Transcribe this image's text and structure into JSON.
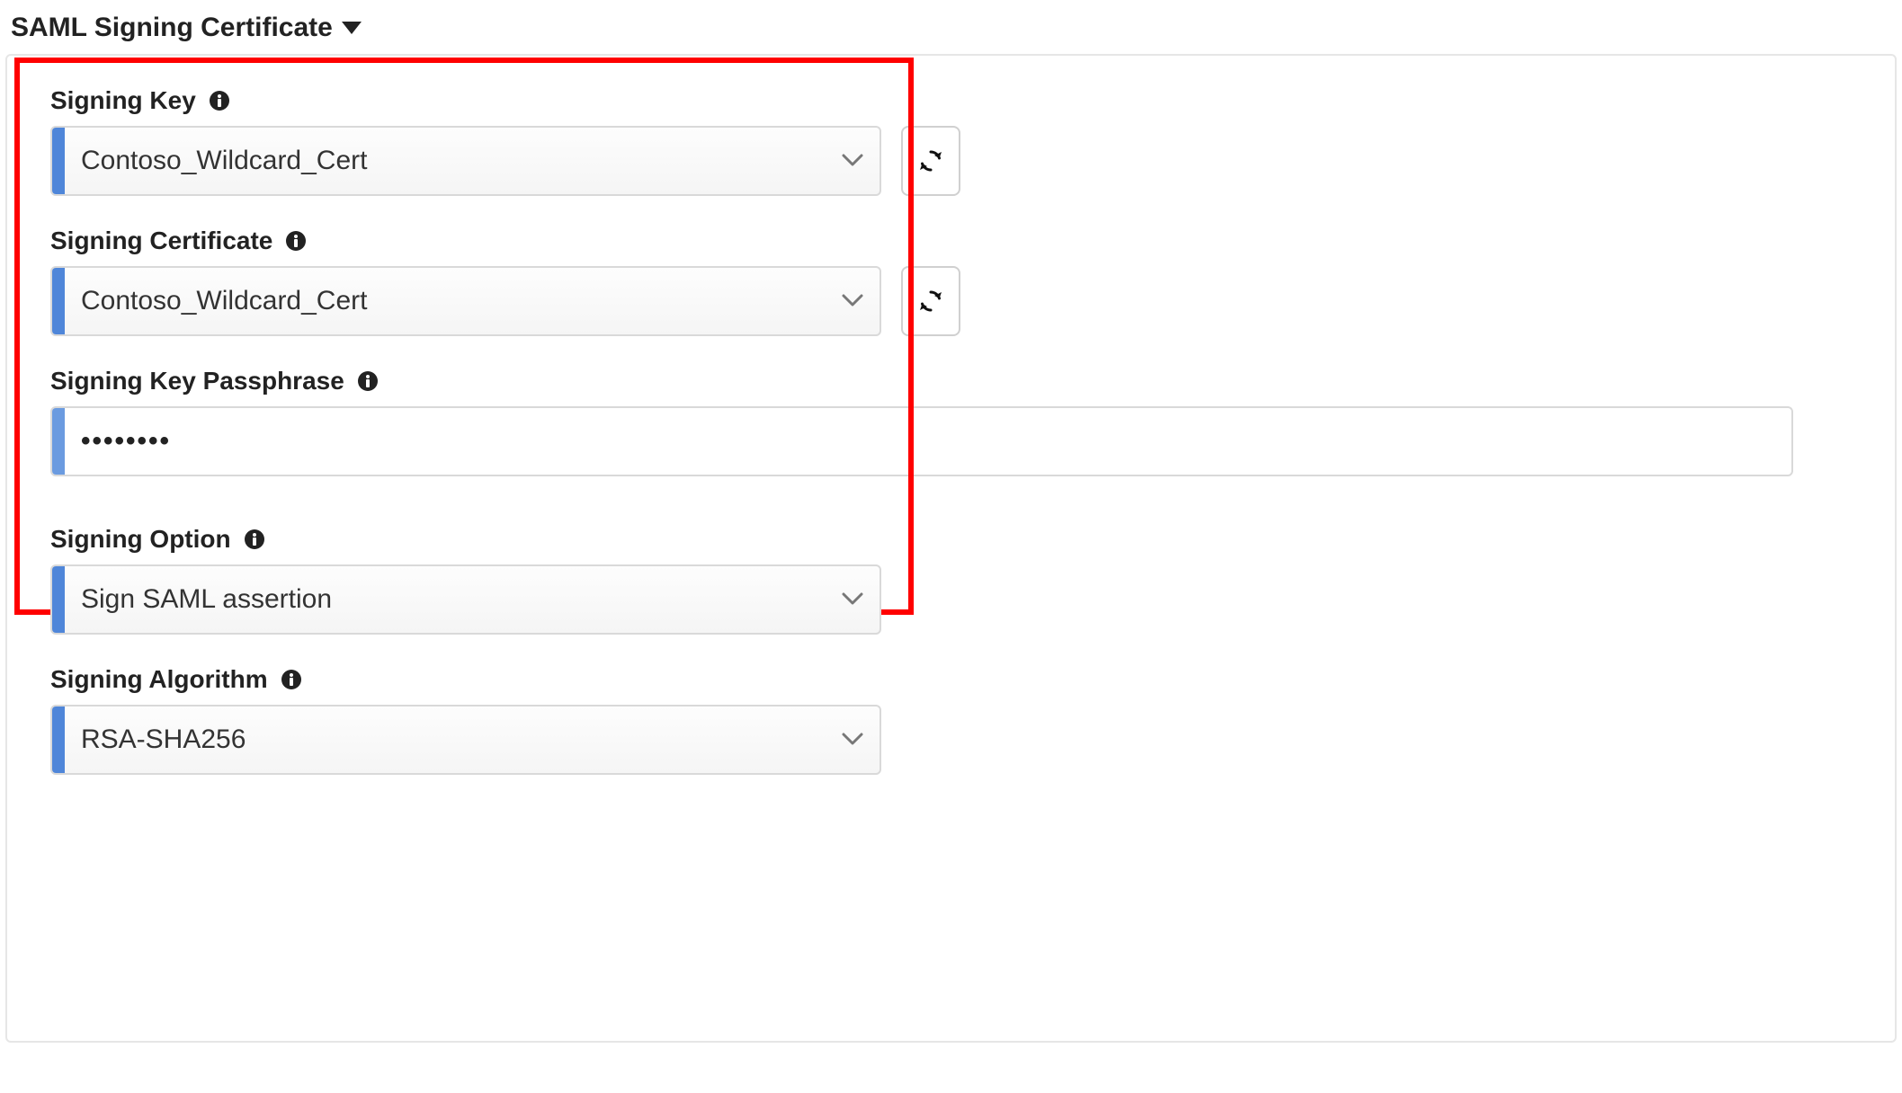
{
  "section": {
    "title": "SAML Signing Certificate"
  },
  "fields": {
    "signingKey": {
      "label": "Signing Key",
      "value": "Contoso_Wildcard_Cert"
    },
    "signingCertificate": {
      "label": "Signing Certificate",
      "value": "Contoso_Wildcard_Cert"
    },
    "signingKeyPassphrase": {
      "label": "Signing Key Passphrase",
      "value": "••••••••"
    },
    "signingOption": {
      "label": "Signing Option",
      "value": "Sign SAML assertion"
    },
    "signingAlgorithm": {
      "label": "Signing Algorithm",
      "value": "RSA-SHA256"
    }
  }
}
